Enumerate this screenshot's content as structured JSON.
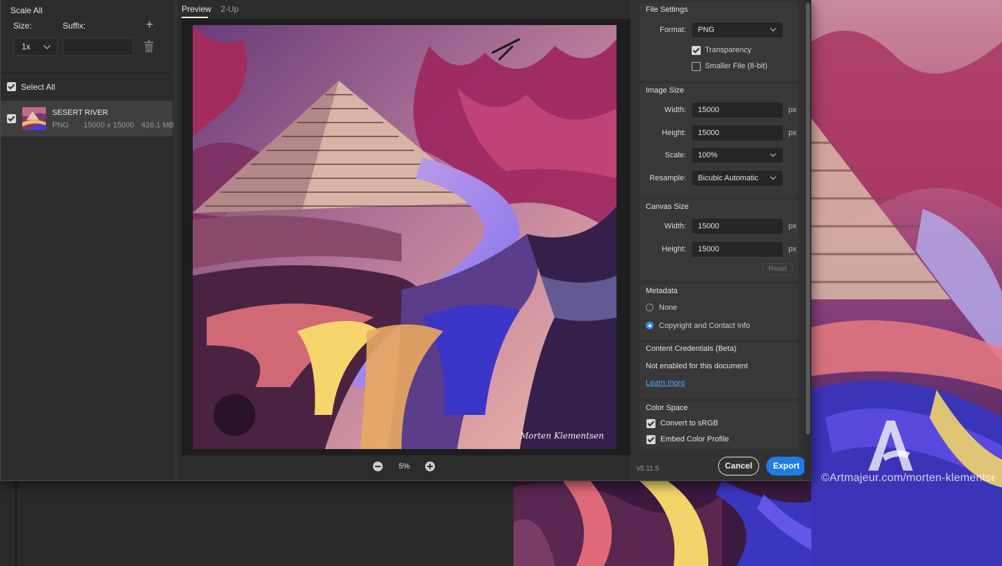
{
  "left_panel": {
    "title": "Scale All",
    "size_label": "Size:",
    "suffix_label": "Suffix:",
    "size_value": "1x",
    "suffix_value": "",
    "select_all_label": "Select All",
    "select_all_checked": true,
    "assets": [
      {
        "name": "SESERT RIVER",
        "format": "PNG",
        "dimensions": "15000 x 15000",
        "file_size": "426.1 MB",
        "checked": true
      }
    ]
  },
  "preview": {
    "tabs": [
      {
        "label": "Preview",
        "active": true
      },
      {
        "label": "2-Up",
        "active": false
      }
    ],
    "zoom": "5%",
    "signature": "Morten Klementsen"
  },
  "file_settings": {
    "title": "File Settings",
    "format_label": "Format:",
    "format_value": "PNG",
    "transparency_label": "Transparency",
    "transparency_checked": true,
    "smaller_file_label": "Smaller File (8-bit)",
    "smaller_file_checked": false
  },
  "image_size": {
    "title": "Image Size",
    "width_label": "Width:",
    "width_value": "15000",
    "height_label": "Height:",
    "height_value": "15000",
    "scale_label": "Scale:",
    "scale_value": "100%",
    "resample_label": "Resample:",
    "resample_value": "Bicubic Automatic",
    "unit": "px"
  },
  "canvas_size": {
    "title": "Canvas Size",
    "width_label": "Width:",
    "width_value": "15000",
    "height_label": "Height:",
    "height_value": "15000",
    "unit": "px",
    "reset_label": "Reset"
  },
  "metadata": {
    "title": "Metadata",
    "options": [
      {
        "label": "None",
        "selected": false
      },
      {
        "label": "Copyright and Contact Info",
        "selected": true
      }
    ]
  },
  "content_credentials": {
    "title": "Content Credentials (Beta)",
    "status": "Not enabled for this document",
    "link": "Learn more"
  },
  "color_space": {
    "title": "Color Space",
    "convert_label": "Convert to sRGB",
    "convert_checked": true,
    "embed_label": "Embed Color Profile",
    "embed_checked": true
  },
  "footer": {
    "version": "v5.11.5",
    "cancel_label": "Cancel",
    "export_label": "Export"
  },
  "background": {
    "watermark": "©Artmajeur.com/morten-klementsen"
  },
  "colors": {
    "accent": "#1f7be6",
    "link": "#4aa3ff",
    "radio_selected": "#2f8ef4",
    "dialog_bg": "#323232"
  }
}
